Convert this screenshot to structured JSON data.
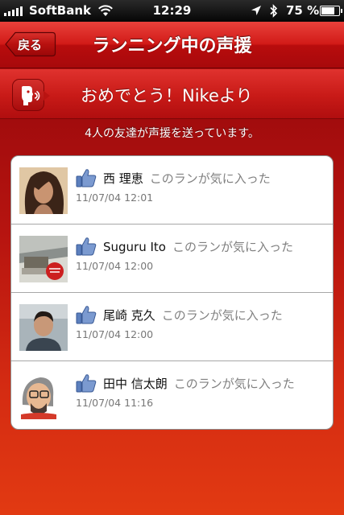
{
  "status_bar": {
    "carrier": "SoftBank",
    "time": "12:29",
    "battery": "75 %",
    "battery_level": 0.75,
    "icons": [
      "signal-icon",
      "wifi-icon",
      "location-icon",
      "bluetooth-icon",
      "battery-icon"
    ]
  },
  "nav": {
    "back_label": "戻る",
    "title": "ランニング中の声援"
  },
  "banner": {
    "icon": "voice-cheer-icon",
    "text": "おめでとう！Nikeより"
  },
  "summary": "4人の友達が声援を送っています。",
  "cheers": [
    {
      "name": "西 理恵",
      "message": "このランが気に入った",
      "time": "11/07/04 12:01"
    },
    {
      "name": "Suguru Ito",
      "message": "このランが気に入った",
      "time": "11/07/04 12:00"
    },
    {
      "name": "尾崎 克久",
      "message": "このランが気に入った",
      "time": "11/07/04 12:00"
    },
    {
      "name": "田中 信太朗",
      "message": "このランが気に入った",
      "time": "11/07/04 11:16"
    }
  ],
  "colors": {
    "accent": "#c81a17",
    "like": "#4a6ea9"
  }
}
